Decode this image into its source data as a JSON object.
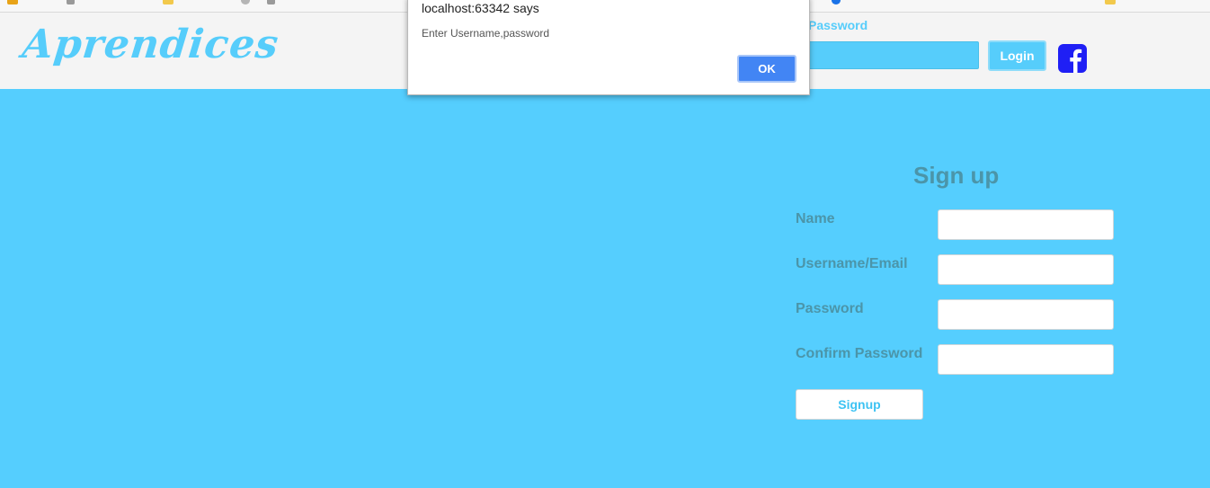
{
  "dialog": {
    "title": "localhost:63342 says",
    "message": "Enter Username,password",
    "ok_label": "OK"
  },
  "header": {
    "logo_text": "Aprendices",
    "password_label": "Password",
    "login_label": "Login",
    "facebook_icon": "facebook-icon"
  },
  "signup": {
    "title": "Sign up",
    "fields": [
      {
        "label": "Name",
        "value": ""
      },
      {
        "label": "Username/Email",
        "value": ""
      },
      {
        "label": "Password",
        "value": ""
      },
      {
        "label": "Confirm Password",
        "value": ""
      }
    ],
    "button_label": "Signup"
  },
  "colors": {
    "brand_blue": "#56cdfb",
    "main_bg": "#55cefe",
    "label_text": "#4b95a9",
    "facebook": "#1f1ff5",
    "dialog_ok": "#4285f4"
  }
}
